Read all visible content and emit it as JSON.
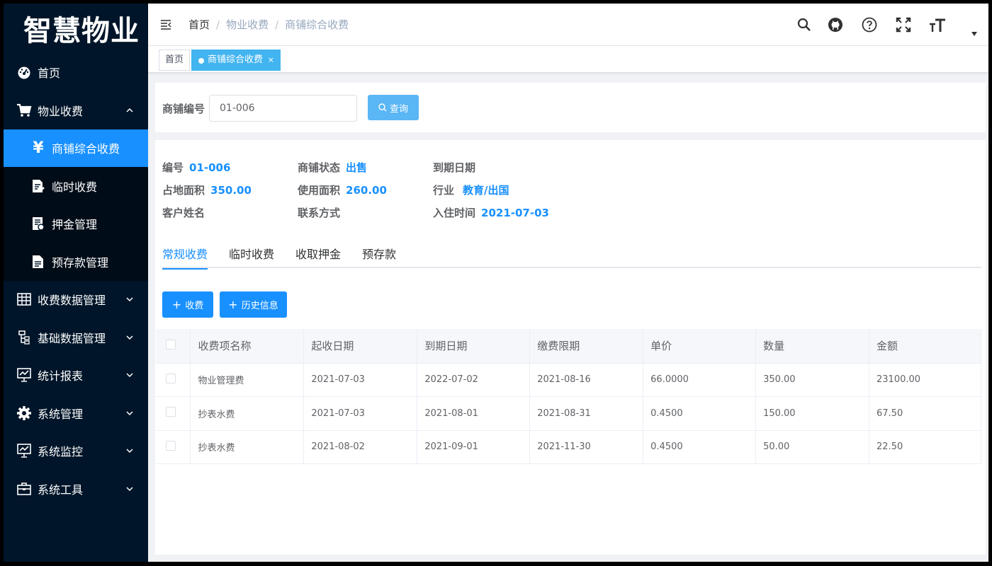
{
  "app": {
    "logo": "智慧物业"
  },
  "sidebar": {
    "items": [
      {
        "label": "首页",
        "icon": "dashboard-icon"
      },
      {
        "label": "物业收费",
        "icon": "cart-icon",
        "expanded": true,
        "children": [
          {
            "label": "商铺综合收费",
            "icon": "yen-icon",
            "active": true
          },
          {
            "label": "临时收费",
            "icon": "edit-doc-icon"
          },
          {
            "label": "押金管理",
            "icon": "receipt-icon"
          },
          {
            "label": "预存款管理",
            "icon": "document-icon"
          }
        ]
      },
      {
        "label": "收费数据管理",
        "icon": "table-icon"
      },
      {
        "label": "基础数据管理",
        "icon": "tree-icon"
      },
      {
        "label": "统计报表",
        "icon": "chart-icon"
      },
      {
        "label": "系统管理",
        "icon": "gear-icon"
      },
      {
        "label": "系统监控",
        "icon": "monitor-icon"
      },
      {
        "label": "系统工具",
        "icon": "toolbox-icon"
      }
    ]
  },
  "header": {
    "breadcrumb": [
      "首页",
      "物业收费",
      "商铺综合收费"
    ],
    "separator": "/",
    "icons": [
      "search-icon",
      "github-icon",
      "help-icon",
      "fullscreen-icon",
      "font-size-icon"
    ]
  },
  "tags": {
    "home": "首页",
    "active": "商铺综合收费",
    "close": "×"
  },
  "search": {
    "label": "商铺编号",
    "value": "01-006",
    "button": "查询"
  },
  "shop_info": {
    "number_label": "编号",
    "number": "01-006",
    "status_label": "商铺状态",
    "status": "出售",
    "expire_label": "到期日期",
    "expire": "",
    "area_label": "占地面积",
    "area": "350.00",
    "use_area_label": "使用面积",
    "use_area": "260.00",
    "industry_label": "行业",
    "industry": "教育/出国",
    "customer_label": "客户姓名",
    "customer": "",
    "contact_label": "联系方式",
    "contact": "",
    "checkin_label": "入住时间",
    "checkin": "2021-07-03"
  },
  "tabs": [
    "常规收费",
    "临时收费",
    "收取押金",
    "预存款"
  ],
  "actions": {
    "charge": "收费",
    "history": "历史信息",
    "plus": "+"
  },
  "table": {
    "headers": [
      "收费项名称",
      "起收日期",
      "到期日期",
      "缴费限期",
      "单价",
      "数量",
      "金额"
    ],
    "rows": [
      [
        "物业管理费",
        "2021-07-03",
        "2022-07-02",
        "2021-08-16",
        "66.0000",
        "350.00",
        "23100.00"
      ],
      [
        "抄表水费",
        "2021-07-03",
        "2021-08-01",
        "2021-08-31",
        "0.4500",
        "150.00",
        "67.50"
      ],
      [
        "抄表水费",
        "2021-08-02",
        "2021-09-01",
        "2021-11-30",
        "0.4500",
        "50.00",
        "22.50"
      ]
    ]
  },
  "colors": {
    "sidebar_bg": "#001529",
    "accent": "#1890ff",
    "tag_active": "#42b4f0"
  }
}
